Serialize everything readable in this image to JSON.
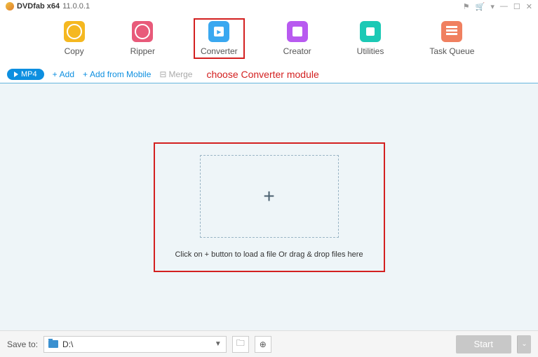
{
  "titlebar": {
    "app_name": "DVDfab x64",
    "version": "11.0.0.1"
  },
  "modules": [
    {
      "key": "copy",
      "label": "Copy",
      "icon": "copy-icon"
    },
    {
      "key": "ripper",
      "label": "Ripper",
      "icon": "ripper-icon"
    },
    {
      "key": "converter",
      "label": "Converter",
      "icon": "converter-icon",
      "selected": true
    },
    {
      "key": "creator",
      "label": "Creator",
      "icon": "creator-icon"
    },
    {
      "key": "utilities",
      "label": "Utilities",
      "icon": "utilities-icon"
    },
    {
      "key": "task_queue",
      "label": "Task Queue",
      "icon": "queue-icon"
    }
  ],
  "toolbar": {
    "format_badge": "MP4",
    "add": "Add",
    "add_mobile": "Add from Mobile",
    "merge": "Merge"
  },
  "annotation": "choose Converter module",
  "dropzone": {
    "plus": "+",
    "hint": "Click on + button to load a file Or drag & drop files here"
  },
  "bottombar": {
    "save_label": "Save to:",
    "path": "D:\\",
    "start": "Start"
  }
}
